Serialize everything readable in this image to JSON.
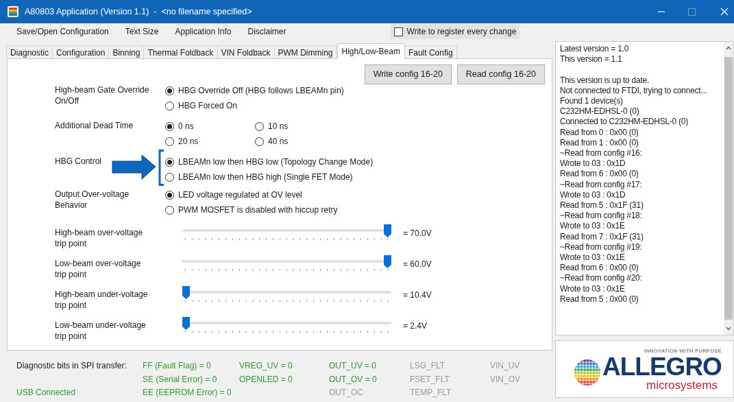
{
  "window": {
    "title": "A80803 Application (Version 1.1)  -  <no filename specified>"
  },
  "menu": [
    "Save/Open Configuration",
    "Text Size",
    "Application Info",
    "Disclaimer"
  ],
  "write_every_change": {
    "label": "Write to register every change",
    "checked": false
  },
  "tabs": [
    {
      "label": "Diagnostic",
      "selected": false
    },
    {
      "label": "Configuration",
      "selected": false
    },
    {
      "label": "Binning",
      "selected": false
    },
    {
      "label": "Thermal Foldback",
      "selected": false
    },
    {
      "label": "VIN Foldback",
      "selected": false
    },
    {
      "label": "PWM Dimming",
      "selected": false
    },
    {
      "label": "High/Low-Beam",
      "selected": true
    },
    {
      "label": "Fault Config",
      "selected": false
    }
  ],
  "buttons": [
    "Write config 16-20",
    "Read config 16-20"
  ],
  "options": [
    {
      "label": "High-beam Gate Override On/Off",
      "kind": "list",
      "choices": [
        {
          "label": "HBG Override Off (HBG follows LBEAMn pin)",
          "selected": true
        },
        {
          "label": "HBG Forced On",
          "selected": false
        }
      ]
    },
    {
      "label": "Additional Dead Time",
      "kind": "grid",
      "choices": [
        {
          "label": "0 ns",
          "selected": true
        },
        {
          "label": "10 ns",
          "selected": false
        },
        {
          "label": "20 ns",
          "selected": false
        },
        {
          "label": "40 ns",
          "selected": false
        }
      ]
    },
    {
      "label": "HBG Control",
      "kind": "list",
      "highlighted": true,
      "choices": [
        {
          "label": "LBEAMn low then HBG low (Topology Change Mode)",
          "selected": true
        },
        {
          "label": "LBEAMn low then HBG high (Single FET Mode)",
          "selected": false
        }
      ]
    },
    {
      "label": "Output Over-voltage Behavior",
      "kind": "list",
      "choices": [
        {
          "label": "LED voltage regulated at OV level",
          "selected": true
        },
        {
          "label": "PWM MOSFET is disabled with hiccup retry",
          "selected": false
        }
      ]
    }
  ],
  "sliders": [
    {
      "label": "High-beam over-voltage trip point",
      "level": 1,
      "reading": "= 70.0V"
    },
    {
      "label": "Low-beam over-voltage trip point",
      "level": 1,
      "reading": "= 60.0V"
    },
    {
      "label": "High-beam under-voltage trip point",
      "level": 0,
      "reading": "= 10.4V"
    },
    {
      "label": "Low-beam under-voltage trip point",
      "level": 0,
      "reading": "= 2.4V"
    }
  ],
  "diagnostics": {
    "label": "Diagnostic bits in SPI transfer:",
    "columns": [
      [
        {
          "text": "FF (Fault Flag) = 0",
          "active": true
        },
        {
          "text": "SE (Serial Error) = 0",
          "active": true
        },
        {
          "text": "EE (EEPROM Error) = 0",
          "active": true
        }
      ],
      [
        {
          "text": "VREG_UV = 0",
          "active": true
        },
        {
          "text": "OPENLED = 0",
          "active": true
        }
      ],
      [
        {
          "text": "OUT_UV = 0",
          "active": true
        },
        {
          "text": "OUT_OV = 0",
          "active": true
        },
        {
          "text": "OUT_OC",
          "active": false
        }
      ],
      [
        {
          "text": "LSG_FLT",
          "active": false
        },
        {
          "text": "FSET_FLT",
          "active": false
        },
        {
          "text": "TEMP_FLT",
          "active": false
        }
      ],
      [
        {
          "text": "VIN_UV",
          "active": false
        },
        {
          "text": "VIN_OV",
          "active": false
        }
      ]
    ]
  },
  "usb_status": "USB Connected",
  "log": [
    {
      "text": "Latest version = 1.0"
    },
    {
      "text": "This version = 1.1"
    },
    {
      "text": "This version is up to date.",
      "gap_before": true
    },
    {
      "text": "Not connected to FTDI, trying to connect..."
    },
    {
      "text": "Found 1 device(s)"
    },
    {
      "text": "C232HM-EDHSL-0 (0)"
    },
    {
      "text": "Connected to C232HM-EDHSL-0 (0)"
    },
    {
      "text": "Read from 0 : 0x00 (0)"
    },
    {
      "text": "Read from 1 : 0x00 (0)"
    },
    {
      "text": "~Read from config #16:"
    },
    {
      "text": "Wrote to 03 : 0x1D"
    },
    {
      "text": "Read from 6 : 0x00 (0)"
    },
    {
      "text": "~Read from config #17:"
    },
    {
      "text": "Wrote to 03 : 0x1D"
    },
    {
      "text": "Read from 5 : 0x1F (31)"
    },
    {
      "text": "~Read from config #18:"
    },
    {
      "text": "Wrote to 03 : 0x1E"
    },
    {
      "text": "Read from 7 : 0x1F (31)"
    },
    {
      "text": "~Read from config #19:"
    },
    {
      "text": "Wrote to 03 : 0x1E"
    },
    {
      "text": "Read from 6 : 0x00 (0)"
    },
    {
      "text": "~Read from config #20:"
    },
    {
      "text": "Wrote to 03 : 0x1E"
    },
    {
      "text": "Read from 5 : 0x00 (0)"
    }
  ],
  "logo": {
    "tagline": "INNOVATION WITH PURPOSE",
    "name": "ALLEGRO",
    "subtitle": "microsystems"
  }
}
